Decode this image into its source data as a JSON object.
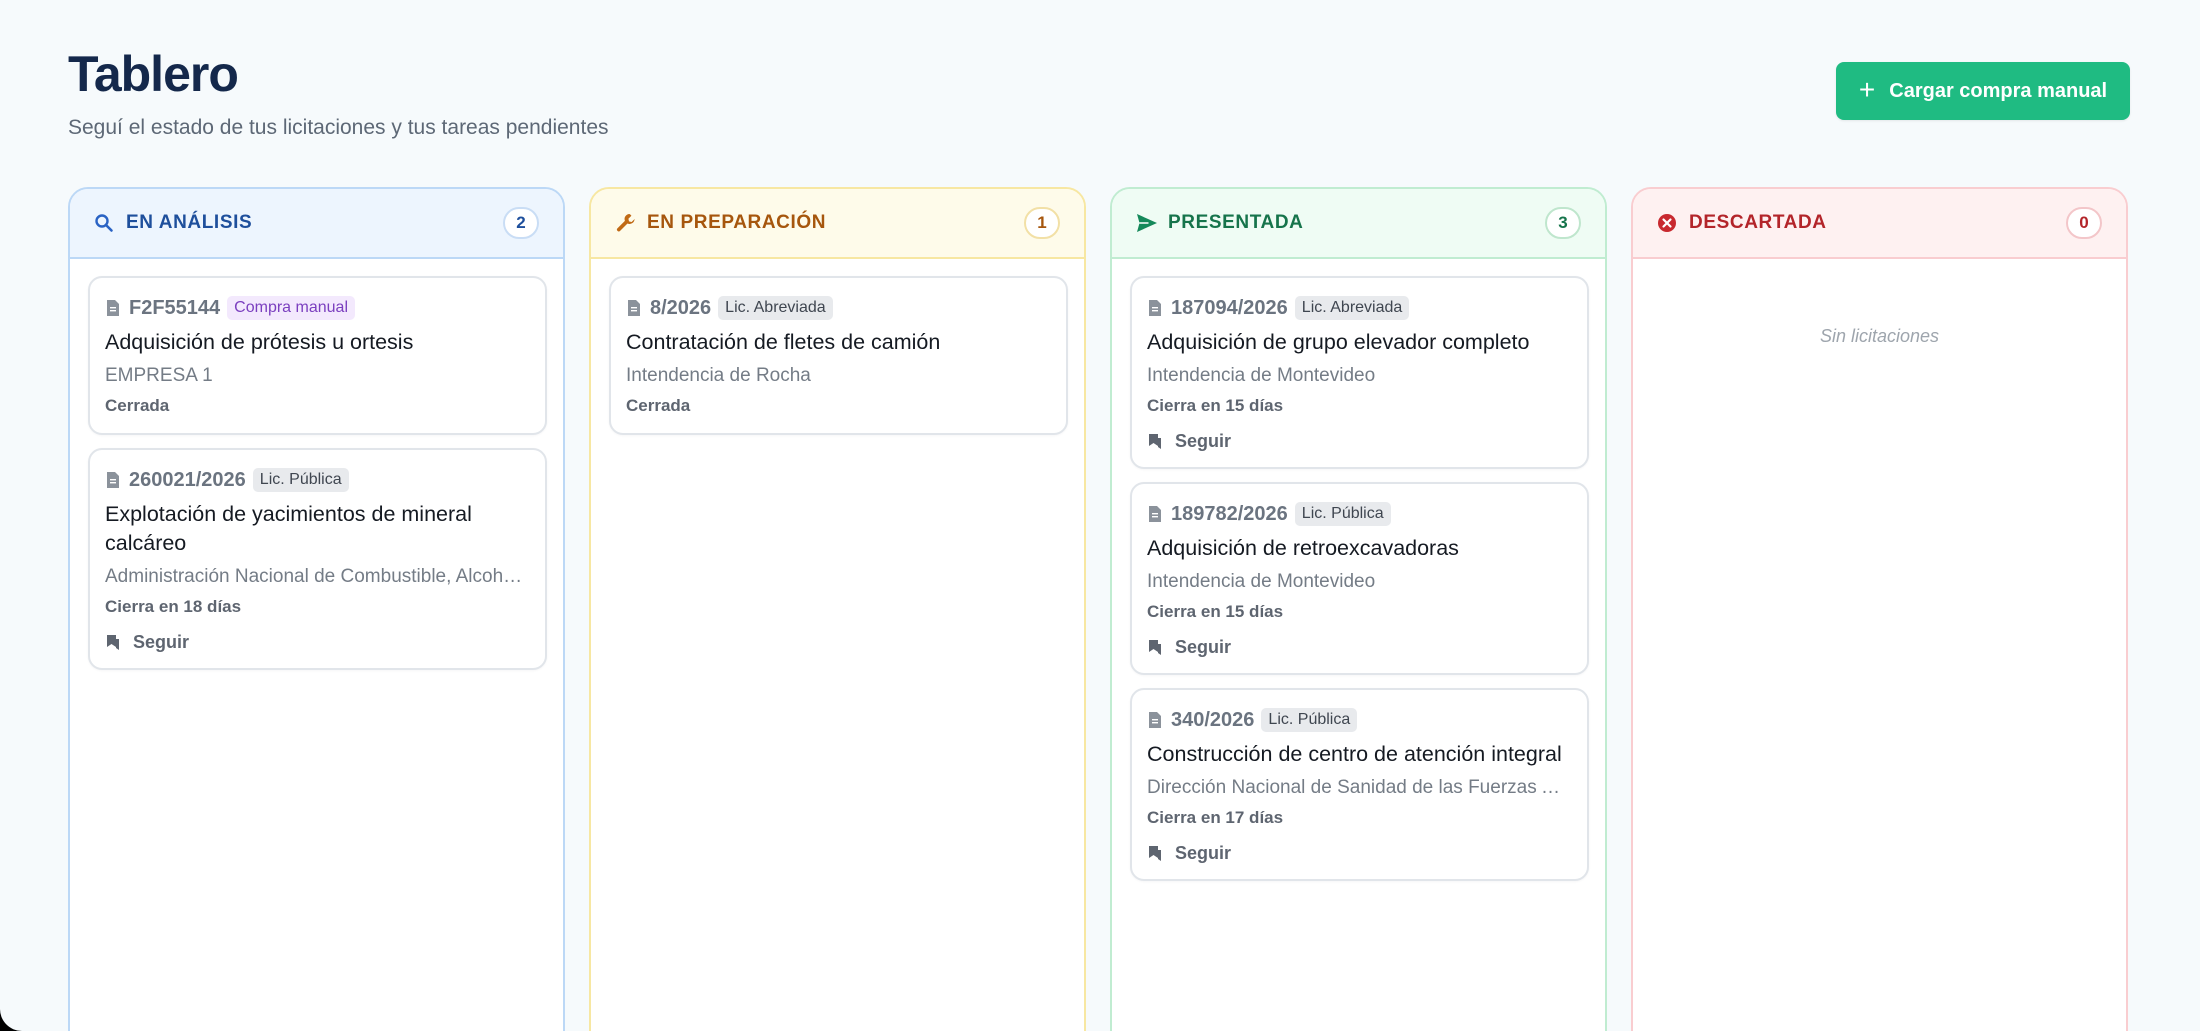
{
  "header": {
    "title": "Tablero",
    "subtitle": "Seguí el estado de tus licitaciones y tus tareas pendientes",
    "add_button_label": "Cargar compra manual",
    "add_icon": "plus-icon"
  },
  "colors": {
    "accent": "#1fbb82",
    "analysis": "#1e4f9c",
    "preparation": "#a6560d",
    "presented": "#16744b",
    "discarded": "#b3252a"
  },
  "columns": [
    {
      "name": "EN ANÁLISIS",
      "icon": "search-icon",
      "count": "2",
      "cards": [
        {
          "code": "F2F55144",
          "tag": "Compra manual",
          "title": "Adquisición de prótesis u ortesis",
          "org": "EMPRESA 1",
          "status": "Cerrada"
        },
        {
          "code": "260021/2026",
          "tag": "Lic. Pública",
          "title": "Explotación de yacimientos de mineral calcáreo",
          "org": "Administración Nacional de Combustible, Alcohol y Portland",
          "status": "Cierra en 18 días",
          "follow": "Seguir"
        }
      ]
    },
    {
      "name": "EN PREPARACIÓN",
      "icon": "wrench-icon",
      "count": "1",
      "cards": [
        {
          "code": "8/2026",
          "tag": "Lic. Abreviada",
          "title": "Contratación de fletes de camión",
          "org": "Intendencia de Rocha",
          "status": "Cerrada"
        }
      ]
    },
    {
      "name": "PRESENTADA",
      "icon": "send-icon",
      "count": "3",
      "cards": [
        {
          "code": "187094/2026",
          "tag": "Lic. Abreviada",
          "title": "Adquisición de grupo elevador completo",
          "org": "Intendencia de Montevideo",
          "status": "Cierra en 15 días",
          "follow": "Seguir"
        },
        {
          "code": "189782/2026",
          "tag": "Lic. Pública",
          "title": "Adquisición de retroexcavadoras",
          "org": "Intendencia de Montevideo",
          "status": "Cierra en 15 días",
          "follow": "Seguir"
        },
        {
          "code": "340/2026",
          "tag": "Lic. Pública",
          "title": "Construcción de centro de atención integral",
          "org": "Dirección Nacional de Sanidad de las Fuerzas Armadas",
          "status": "Cierra en 17 días",
          "follow": "Seguir"
        }
      ]
    },
    {
      "name": "DESCARTADA",
      "icon": "x-circle-icon",
      "count": "0",
      "empty_text": "Sin licitaciones"
    }
  ]
}
